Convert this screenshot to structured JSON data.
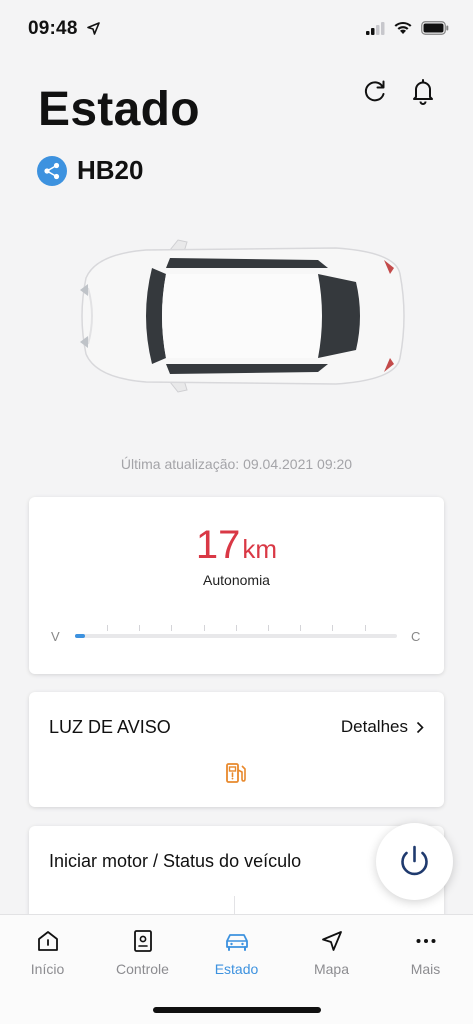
{
  "status_bar": {
    "time": "09:48",
    "icons": [
      "location-arrow-icon",
      "signal-icon",
      "wifi-icon",
      "battery-icon"
    ]
  },
  "header": {
    "title": "Estado",
    "vehicle_name": "HB20",
    "actions": [
      "refresh-icon",
      "bell-icon"
    ]
  },
  "last_update": "Última atualização: 09.04.2021 09:20",
  "range_card": {
    "value": "17",
    "unit": "km",
    "label": "Autonomia",
    "empty_label": "V",
    "full_label": "C",
    "fuel_level_fraction": 0.03,
    "accent_color": "#d93845"
  },
  "warning_card": {
    "title": "LUZ DE AVISO",
    "details_label": "Detalhes",
    "icon": "fuel-pump-warning-icon",
    "icon_color": "#e8892c"
  },
  "engine_card": {
    "title": "Iniciar motor / Status do veículo"
  },
  "power_button": {
    "icon": "power-icon",
    "color": "#1f3a6e"
  },
  "tabs": [
    {
      "label": "Início",
      "icon": "home-icon",
      "active": false
    },
    {
      "label": "Controle",
      "icon": "remote-control-icon",
      "active": false
    },
    {
      "label": "Estado",
      "icon": "car-icon",
      "active": true
    },
    {
      "label": "Mapa",
      "icon": "navigation-arrow-icon",
      "active": false
    },
    {
      "label": "Mais",
      "icon": "more-dots-icon",
      "active": false
    }
  ],
  "colors": {
    "accent": "#3d92df",
    "background": "#f4f4f5"
  }
}
